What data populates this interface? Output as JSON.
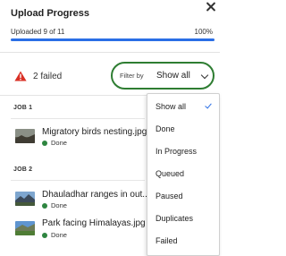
{
  "header": {
    "title": "Upload Progress",
    "close_icon": "close-icon"
  },
  "progress": {
    "uploaded_text": "Uploaded 9 of 11",
    "percent_text": "100%",
    "percent": 100,
    "color": "#2b6fe6"
  },
  "summary": {
    "warning_icon": "warning-triangle-icon",
    "warning_color": "#d93025",
    "failed_text": "2 failed"
  },
  "filter": {
    "label": "Filter by",
    "value": "Show all",
    "chevron_icon": "chevron-down-icon",
    "border_color": "#2e7d32"
  },
  "jobs": [
    {
      "label": "JOB 1",
      "files": [
        {
          "name": "Migratory birds nesting.jpg",
          "status": "Done"
        }
      ]
    },
    {
      "label": "JOB 2",
      "files": [
        {
          "name": "Dhauladhar ranges in out...",
          "status": "Done"
        },
        {
          "name": "Park facing Himalayas.jpg",
          "status": "Done"
        }
      ]
    }
  ],
  "status_color": "#2e8540",
  "dropdown": {
    "options": [
      "Show all",
      "Done",
      "In Progress",
      "Queued",
      "Paused",
      "Duplicates",
      "Failed"
    ],
    "selected": "Show all",
    "check_icon": "checkmark-icon"
  }
}
